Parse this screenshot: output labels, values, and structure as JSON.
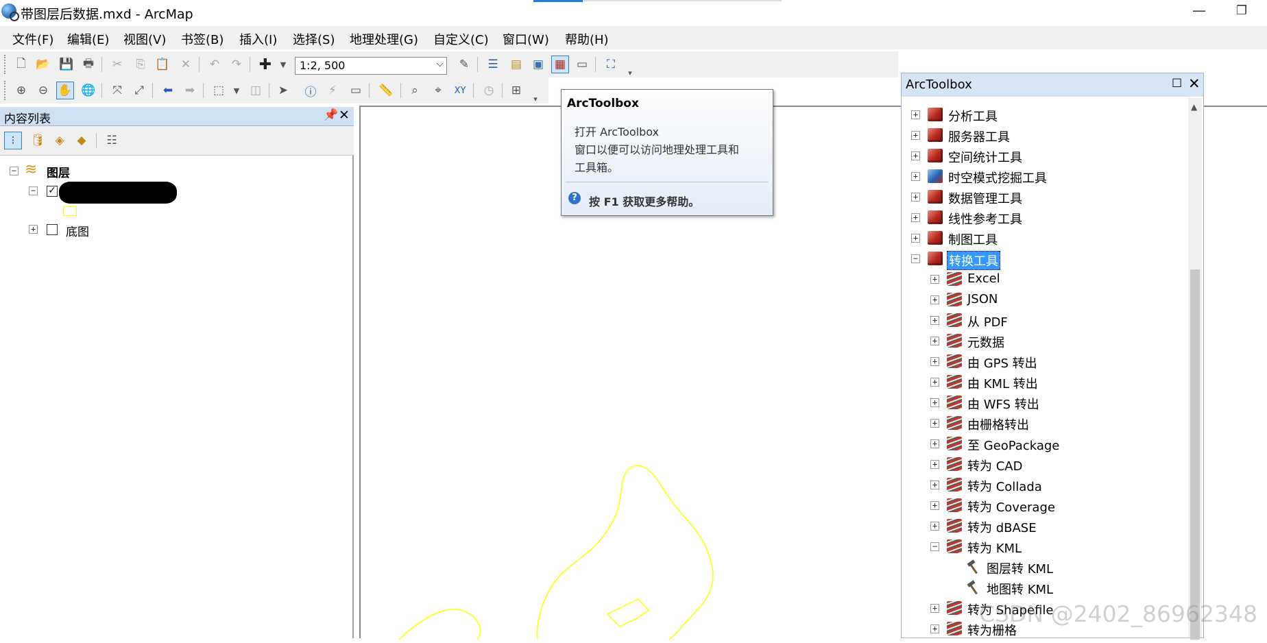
{
  "window": {
    "title": "带图层后数据.mxd - ArcMap",
    "min": "—",
    "max": "❐"
  },
  "menu": [
    "文件(F)",
    "编辑(E)",
    "视图(V)",
    "书签(B)",
    "插入(I)",
    "选择(S)",
    "地理处理(G)",
    "自定义(C)",
    "窗口(W)",
    "帮助(H)"
  ],
  "toolbar": {
    "scale": "1:2, 500"
  },
  "toc": {
    "title": "内容列表",
    "root": "图层",
    "layer2": "底图"
  },
  "tooltip": {
    "title": "ArcToolbox",
    "line1": "打开 ArcToolbox",
    "line2": "窗口以便可以访问地理处理工具和",
    "line3": "工具箱。",
    "help": "按 F1 获取更多帮助。"
  },
  "arctoolbox": {
    "title": "ArcToolbox",
    "toolboxes": [
      "分析工具",
      "服务器工具",
      "空间统计工具",
      "时空模式挖掘工具",
      "数据管理工具",
      "线性参考工具",
      "制图工具",
      "转换工具"
    ],
    "toolsets": [
      "Excel",
      "JSON",
      "从 PDF",
      "元数据",
      "由 GPS 转出",
      "由 KML 转出",
      "由 WFS 转出",
      "由栅格转出",
      "至 GeoPackage",
      "转为 CAD",
      "转为 Collada",
      "转为 Coverage",
      "转为 dBASE",
      "转为 KML"
    ],
    "kml_tools": [
      "图层转 KML",
      "地图转 KML"
    ],
    "after": [
      "转为 Shapefile",
      "转为栅格"
    ]
  },
  "watermark": "CSDN @2402_86962348",
  "colors": {
    "map_line": "#ffff00",
    "selection": "#3399ff",
    "panel_header": "#cfe0f2"
  }
}
